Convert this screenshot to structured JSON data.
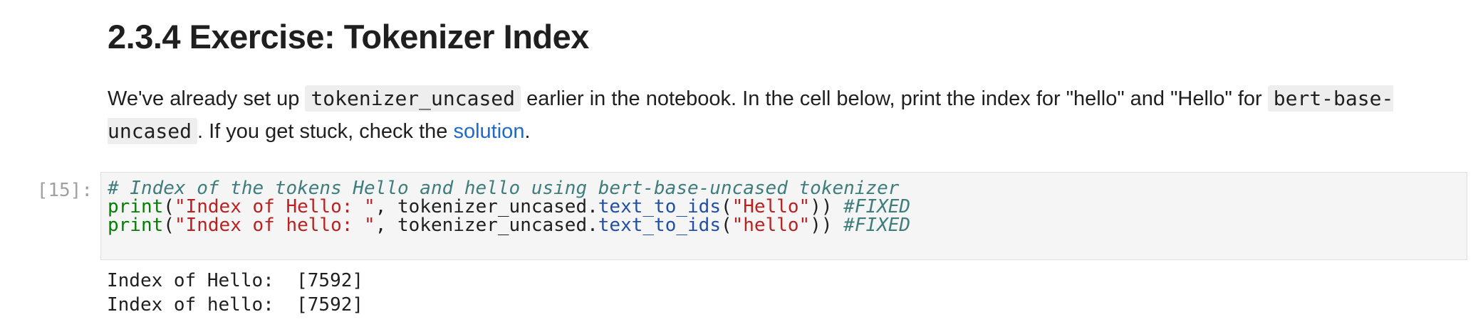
{
  "markdown": {
    "heading": "2.3.4 Exercise: Tokenizer Index",
    "para": {
      "t1": "We've already set up ",
      "code1": "tokenizer_uncased",
      "t2": " earlier in the notebook. In the cell below, print the index for \"hello\" and \"Hello\" for ",
      "code2": "bert-base-uncased",
      "t3": ". If you get stuck, check the ",
      "link": "solution",
      "t4": "."
    }
  },
  "code_cell": {
    "prompt": "[15]:",
    "line1": {
      "comment": "# Index of the tokens Hello and hello using bert-base-uncased tokenizer"
    },
    "line2": {
      "func": "print",
      "open": "(",
      "string": "\"Index of Hello: \"",
      "mid": ", tokenizer_uncased.",
      "method": "text_to_ids",
      "paren": "(",
      "arg": "\"Hello\"",
      "close": "))",
      "comment": " #FIXED"
    },
    "line3": {
      "func": "print",
      "open": "(",
      "string": "\"Index of hello: \"",
      "mid": ", tokenizer_uncased.",
      "method": "text_to_ids",
      "paren": "(",
      "arg": "\"hello\"",
      "close": "))",
      "comment": " #FIXED"
    }
  },
  "output": {
    "line1": "Index of Hello:  [7592]",
    "line2": "Index of hello:  [7592]"
  }
}
